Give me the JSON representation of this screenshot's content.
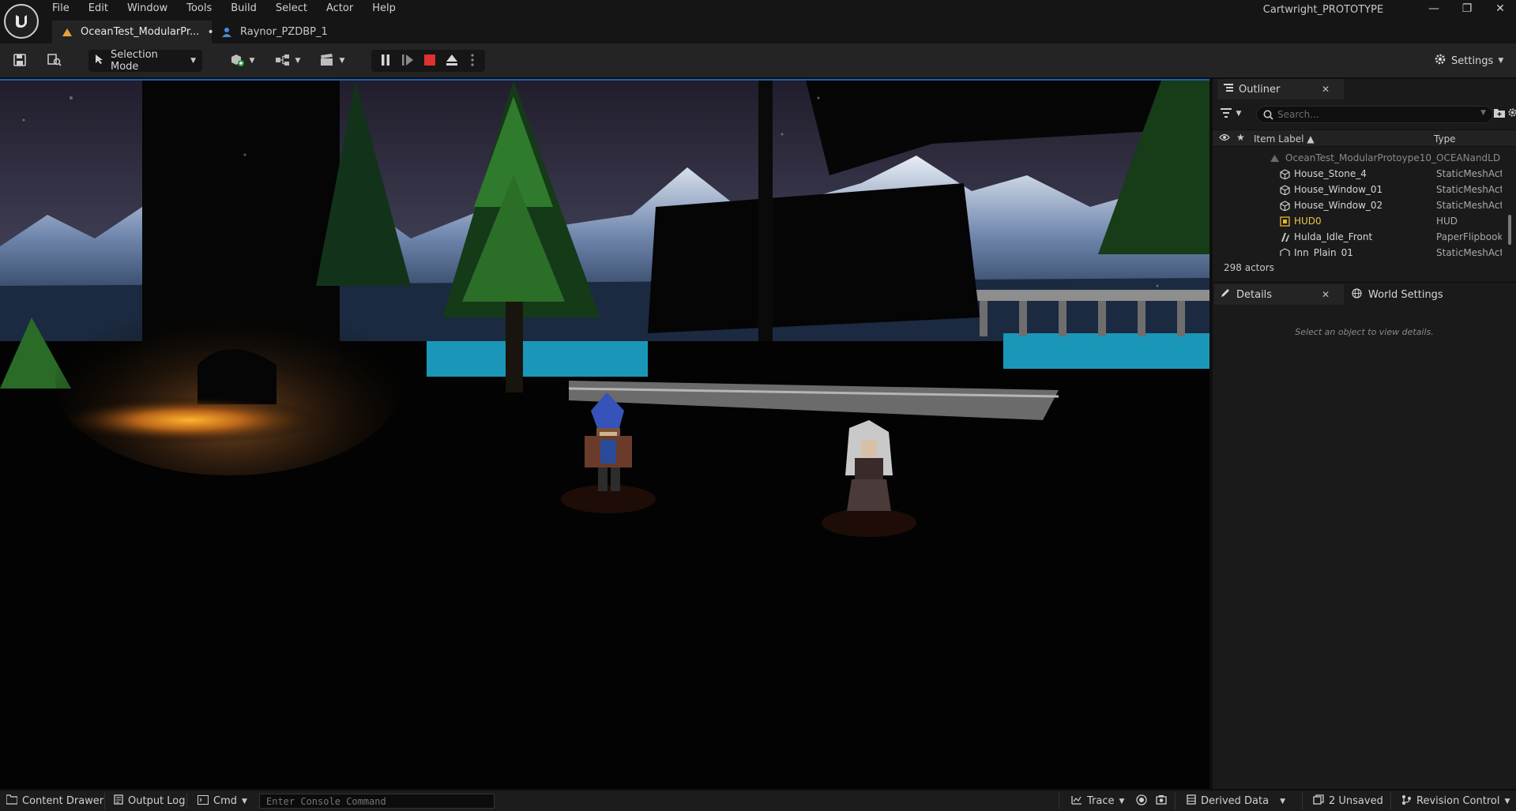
{
  "titlebar": {
    "menu": [
      "File",
      "Edit",
      "Window",
      "Tools",
      "Build",
      "Select",
      "Actor",
      "Help"
    ],
    "project_name": "Cartwright_PROTOTYPE",
    "minimize": "—",
    "restore": "❐",
    "close": "✕",
    "tabs": [
      {
        "label": "OceanTest_ModularPr...",
        "dirty": "•"
      },
      {
        "label": "Raynor_PZDBP_1"
      }
    ]
  },
  "toolbar": {
    "selection_mode": "Selection Mode",
    "settings": "Settings"
  },
  "outliner": {
    "title": "Outliner",
    "close": "✕",
    "search_placeholder": "Search...",
    "col_label": "Item Label ▲",
    "col_type": "Type",
    "level_name": "OceanTest_ModularProtoype10_OCEANandLD (",
    "rows": [
      {
        "label": "House_Stone_4",
        "type": "StaticMeshAct",
        "icon": "static-mesh-icon"
      },
      {
        "label": "House_Window_01",
        "type": "StaticMeshAct",
        "icon": "static-mesh-icon"
      },
      {
        "label": "House_Window_02",
        "type": "StaticMeshAct",
        "icon": "static-mesh-icon"
      },
      {
        "label": "HUD0",
        "type": "HUD",
        "icon": "hud-icon"
      },
      {
        "label": "Hulda_Idle_Front",
        "type": "PaperFlipbook",
        "icon": "flipbook-icon"
      },
      {
        "label": "Inn_Plain_01",
        "type": "StaticMeshAct",
        "icon": "static-mesh-icon"
      }
    ],
    "actor_count": "298 actors"
  },
  "details": {
    "tab_details": "Details",
    "close": "✕",
    "tab_world_settings": "World Settings",
    "hint": "Select an object to view details."
  },
  "statusbar": {
    "content_drawer": "Content Drawer",
    "output_log": "Output Log",
    "cmd": "Cmd",
    "console_placeholder": "Enter Console Command",
    "trace": "Trace",
    "derived_data": "Derived Data",
    "unsaved": "2 Unsaved",
    "revision_control": "Revision Control"
  }
}
